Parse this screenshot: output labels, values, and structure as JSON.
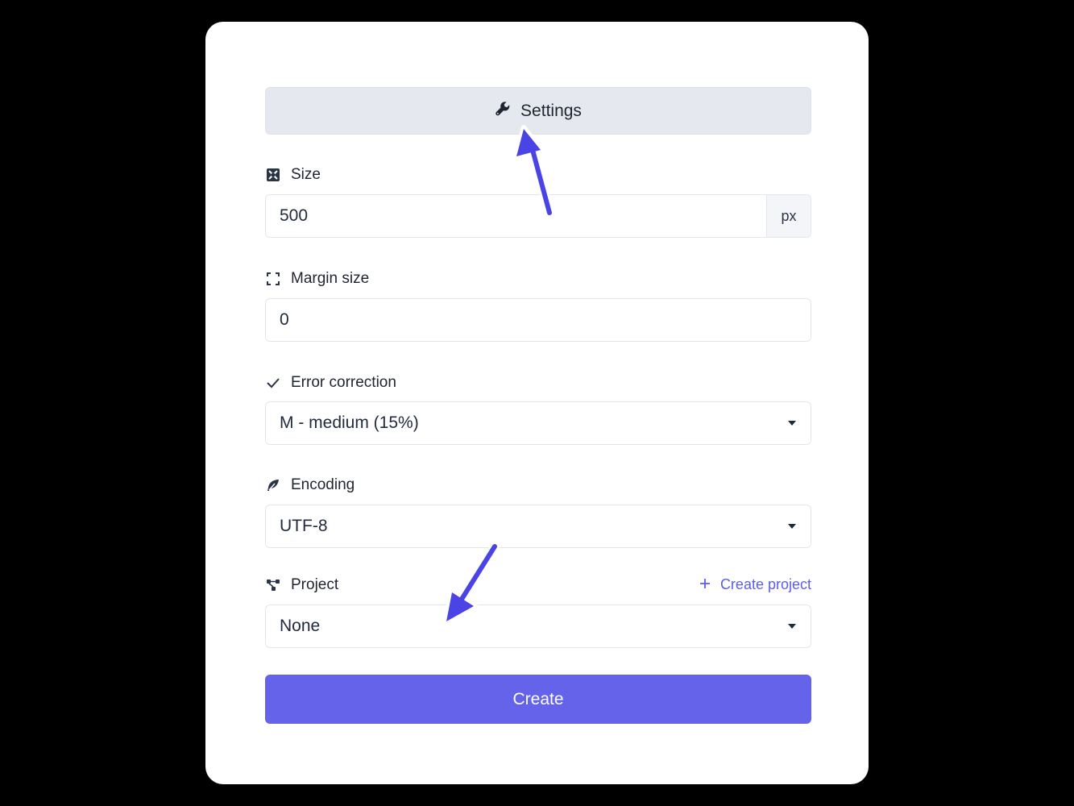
{
  "settings": {
    "label": "Settings",
    "icon": "wrench-icon"
  },
  "size": {
    "label": "Size",
    "icon": "expand-icon",
    "value": "500",
    "unit": "px"
  },
  "margin": {
    "label": "Margin size",
    "icon": "frame-corners-icon",
    "value": "0"
  },
  "error_correction": {
    "label": "Error correction",
    "icon": "check-icon",
    "selected": "M - medium (15%)"
  },
  "encoding": {
    "label": "Encoding",
    "icon": "feather-icon",
    "selected": "UTF-8"
  },
  "project": {
    "label": "Project",
    "icon": "nodes-icon",
    "selected": "None",
    "create_label": "Create project"
  },
  "create_button": {
    "label": "Create"
  },
  "colors": {
    "accent": "#6563ea",
    "link": "#5b5ee8",
    "annotation_arrow": "#4a44e6",
    "page_background": "#000000"
  }
}
